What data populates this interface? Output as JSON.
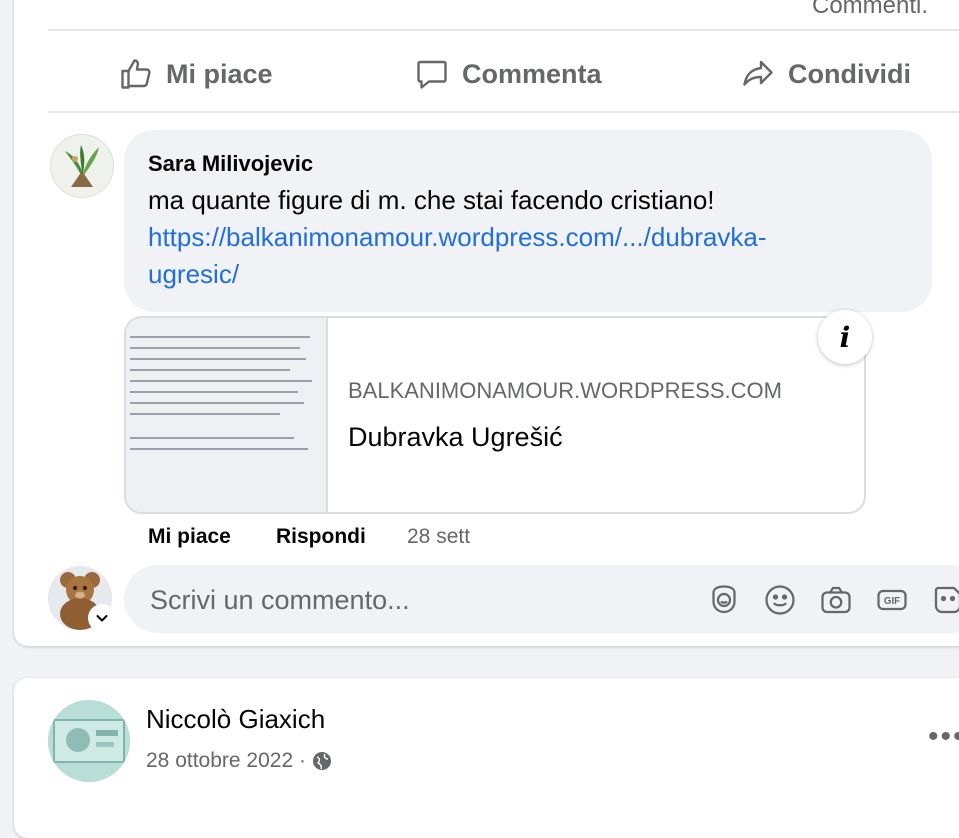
{
  "top": {
    "comments_link": "Commenti."
  },
  "actions": {
    "like": "Mi piace",
    "comment": "Commenta",
    "share": "Condividi"
  },
  "comment": {
    "author": "Sara Milivojevic",
    "text": "ma quante figure di m. che stai facendo cristiano!",
    "link": "https://balkanimonamour.wordpress.com/.../dubravka-ugresic/",
    "link_line1": "https://balkanimonamour.wordpress.com/.../dubravka-",
    "link_line2": "ugresic/",
    "preview": {
      "domain": "BALKANIMONAMOUR.WORDPRESS.COM",
      "title": "Dubravka Ugrešić",
      "info_icon": "info-icon"
    },
    "like_action": "Mi piace",
    "reply_action": "Rispondi",
    "time": "28 sett"
  },
  "composer": {
    "placeholder": "Scrivi un commento...",
    "tools": [
      "avatar-sticker-icon",
      "emoji-icon",
      "camera-icon",
      "gif-icon",
      "sticker-icon"
    ]
  },
  "next_post": {
    "author": "Niccolò Giaxich",
    "date": "28 ottobre 2022 ·",
    "audience_icon": "globe-icon"
  },
  "colors": {
    "link": "#216fdb",
    "secondary": "#65676b",
    "bubble": "#f0f2f5",
    "page_bg": "#f0f2f5"
  }
}
